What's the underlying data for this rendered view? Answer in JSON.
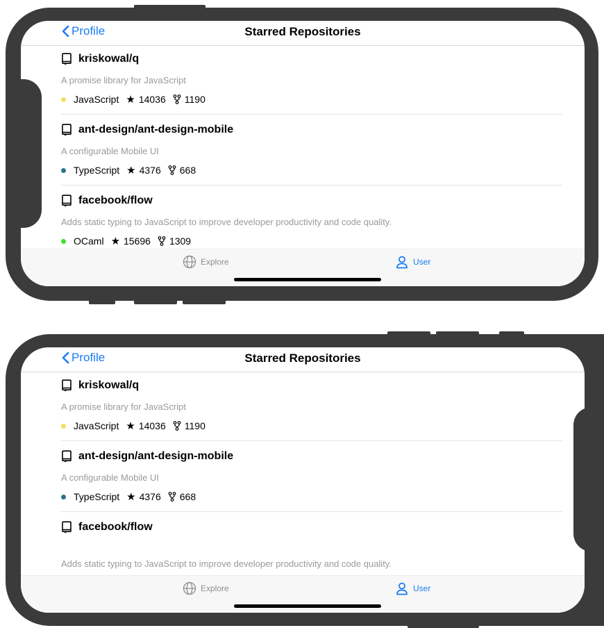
{
  "nav": {
    "back_label": "Profile",
    "title": "Starred Repositories"
  },
  "repos": [
    {
      "name": "kriskowal/q",
      "description": "A promise library for JavaScript",
      "language": "JavaScript",
      "language_color": "#f1e05a",
      "stars": "14036",
      "forks": "1190"
    },
    {
      "name": "ant-design/ant-design-mobile",
      "description": "A configurable Mobile UI",
      "language": "TypeScript",
      "language_color": "#2b7489",
      "stars": "4376",
      "forks": "668"
    },
    {
      "name": "facebook/flow",
      "description": "Adds static typing to JavaScript to improve developer productivity and code quality.",
      "language": "OCaml",
      "language_color": "#3be133",
      "stars": "15696",
      "forks": "1309"
    }
  ],
  "tabs": {
    "explore": {
      "label": "Explore",
      "icon": "globe-icon",
      "active": false
    },
    "user": {
      "label": "User",
      "icon": "user-icon",
      "active": true
    }
  },
  "colors": {
    "accent": "#1a7cf5",
    "inactive": "#8e8e93"
  }
}
